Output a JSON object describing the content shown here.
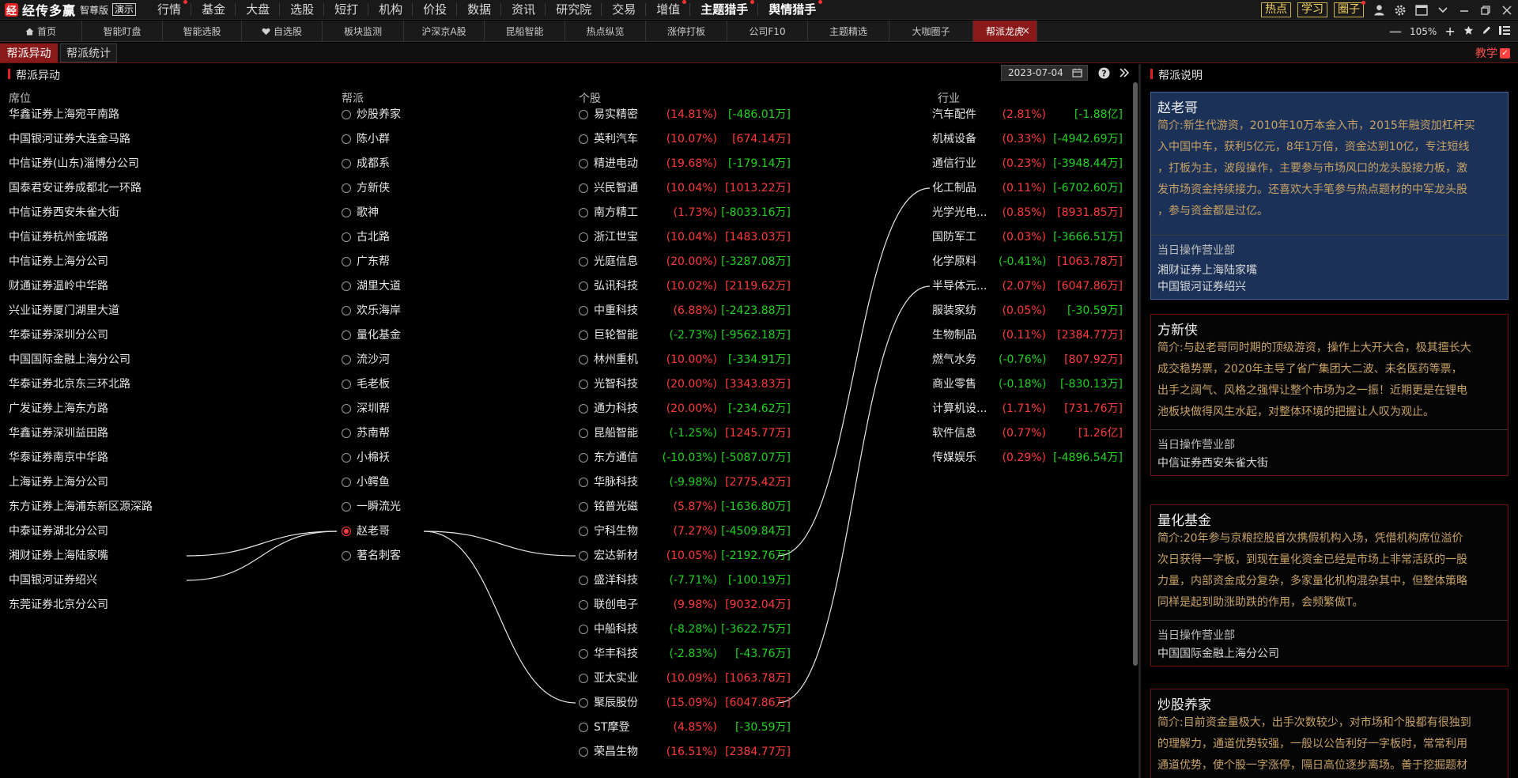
{
  "app": {
    "logo_char": "经",
    "name": "经传多赢",
    "edition": "智尊版",
    "demo_badge": "演示",
    "menu": [
      {
        "label": "行情",
        "dot": true
      },
      {
        "label": "基金",
        "dot": false
      },
      {
        "label": "大盘",
        "dot": false
      },
      {
        "label": "选股",
        "dot": false
      },
      {
        "label": "短打",
        "dot": false
      },
      {
        "label": "机构",
        "dot": false
      },
      {
        "label": "价投",
        "dot": false
      },
      {
        "label": "数据",
        "dot": false
      },
      {
        "label": "资讯",
        "dot": false
      },
      {
        "label": "研究院",
        "dot": false
      },
      {
        "label": "交易",
        "dot": false
      },
      {
        "label": "增值",
        "dot": true
      },
      {
        "label": "主题猎手",
        "dot": true,
        "bold": true
      },
      {
        "label": "舆情猎手",
        "dot": true,
        "bold": true
      }
    ],
    "right_buttons": [
      "热点",
      "学习",
      "圈子"
    ],
    "right_icons": [
      "user-icon",
      "gear-icon",
      "window-icon",
      "chevron-down-icon",
      "minimize-icon",
      "restore-icon",
      "close-icon"
    ]
  },
  "tabs": [
    {
      "label": "首页",
      "icon": "home-icon"
    },
    {
      "label": "智能盯盘"
    },
    {
      "label": "智能选股"
    },
    {
      "label": "自选股",
      "icon": "heart-icon"
    },
    {
      "label": "板块监测"
    },
    {
      "label": "沪深京A股"
    },
    {
      "label": "昆船智能"
    },
    {
      "label": "热点纵览"
    },
    {
      "label": "涨停打板"
    },
    {
      "label": "公司F10"
    },
    {
      "label": "主题精选"
    },
    {
      "label": "大咖圈子"
    },
    {
      "label": "帮派龙虎",
      "active": true,
      "close": "×"
    }
  ],
  "zoom": {
    "minus": "—",
    "value": "105%",
    "plus": "+"
  },
  "subtabs": [
    {
      "label": "帮派异动",
      "active": true
    },
    {
      "label": "帮派统计",
      "active": false
    }
  ],
  "teach_label": "教学",
  "left_panel": {
    "title": "帮派异动",
    "date": "2023-07-04",
    "headers": {
      "seat": "席位",
      "gang": "帮派",
      "stock": "个股",
      "industry": "行业"
    },
    "seats": [
      "华鑫证券上海宛平南路",
      "中国银河证券大连金马路",
      "中信证券(山东)淄博分公司",
      "国泰君安证券成都北一环路",
      "中信证券西安朱雀大街",
      "中信证券杭州金城路",
      "中信证券上海分公司",
      "财通证券温岭中华路",
      "兴业证券厦门湖里大道",
      "华泰证券深圳分公司",
      "中国国际金融上海分公司",
      "华泰证券北京东三环北路",
      "广发证券上海东方路",
      "华鑫证券深圳益田路",
      "华泰证券南京中华路",
      "上海证券上海分公司",
      "东方证券上海浦东新区源深路",
      "中泰证券湖北分公司",
      "湘财证券上海陆家嘴",
      "中国银河证券绍兴",
      "东莞证券北京分公司"
    ],
    "gangs": [
      {
        "name": "炒股养家"
      },
      {
        "name": "陈小群"
      },
      {
        "name": "成都系"
      },
      {
        "name": "方新侠"
      },
      {
        "name": "歌神"
      },
      {
        "name": "古北路"
      },
      {
        "name": "广东帮"
      },
      {
        "name": "湖里大道"
      },
      {
        "name": "欢乐海岸"
      },
      {
        "name": "量化基金"
      },
      {
        "name": "流沙河"
      },
      {
        "name": "毛老板"
      },
      {
        "name": "深圳帮"
      },
      {
        "name": "苏南帮"
      },
      {
        "name": "小棉袄"
      },
      {
        "name": "小鳄鱼"
      },
      {
        "name": "一瞬流光"
      },
      {
        "name": "赵老哥",
        "selected": true
      },
      {
        "name": "著名刺客"
      }
    ],
    "stocks": [
      {
        "name": "易实精密",
        "pct": "(14.81%)",
        "amt": "[-486.01万]",
        "pct_up": true,
        "amt_up": false
      },
      {
        "name": "英利汽车",
        "pct": "(10.07%)",
        "amt": "[674.14万]",
        "pct_up": true,
        "amt_up": true
      },
      {
        "name": "精进电动",
        "pct": "(19.68%)",
        "amt": "[-179.14万]",
        "pct_up": true,
        "amt_up": false
      },
      {
        "name": "兴民智通",
        "pct": "(10.04%)",
        "amt": "[1013.22万]",
        "pct_up": true,
        "amt_up": true
      },
      {
        "name": "南方精工",
        "pct": "(1.73%)",
        "amt": "[-8033.16万]",
        "pct_up": true,
        "amt_up": false
      },
      {
        "name": "浙江世宝",
        "pct": "(10.04%)",
        "amt": "[1483.03万]",
        "pct_up": true,
        "amt_up": true
      },
      {
        "name": "光庭信息",
        "pct": "(20.00%)",
        "amt": "[-3287.08万]",
        "pct_up": true,
        "amt_up": false
      },
      {
        "name": "弘讯科技",
        "pct": "(10.02%)",
        "amt": "[2119.62万]",
        "pct_up": true,
        "amt_up": true
      },
      {
        "name": "中重科技",
        "pct": "(6.88%)",
        "amt": "[-2423.88万]",
        "pct_up": true,
        "amt_up": false
      },
      {
        "name": "巨轮智能",
        "pct": "(-2.73%)",
        "amt": "[-9562.18万]",
        "pct_up": false,
        "amt_up": false
      },
      {
        "name": "林州重机",
        "pct": "(10.00%)",
        "amt": "[-334.91万]",
        "pct_up": true,
        "amt_up": false
      },
      {
        "name": "光智科技",
        "pct": "(20.00%)",
        "amt": "[3343.83万]",
        "pct_up": true,
        "amt_up": true
      },
      {
        "name": "通力科技",
        "pct": "(20.00%)",
        "amt": "[-234.62万]",
        "pct_up": true,
        "amt_up": false
      },
      {
        "name": "昆船智能",
        "pct": "(-1.25%)",
        "amt": "[1245.77万]",
        "pct_up": false,
        "amt_up": true
      },
      {
        "name": "东方通信",
        "pct": "(-10.03%)",
        "amt": "[-5087.07万]",
        "pct_up": false,
        "amt_up": false
      },
      {
        "name": "华脉科技",
        "pct": "(-9.98%)",
        "amt": "[2775.42万]",
        "pct_up": false,
        "amt_up": true
      },
      {
        "name": "铭普光磁",
        "pct": "(5.87%)",
        "amt": "[-1636.80万]",
        "pct_up": true,
        "amt_up": false
      },
      {
        "name": "宁科生物",
        "pct": "(7.27%)",
        "amt": "[-4509.84万]",
        "pct_up": true,
        "amt_up": false
      },
      {
        "name": "宏达新材",
        "pct": "(10.05%)",
        "amt": "[-2192.76万]",
        "pct_up": true,
        "amt_up": false
      },
      {
        "name": "盛洋科技",
        "pct": "(-7.71%)",
        "amt": "[-100.19万]",
        "pct_up": false,
        "amt_up": false
      },
      {
        "name": "联创电子",
        "pct": "(9.98%)",
        "amt": "[9032.04万]",
        "pct_up": true,
        "amt_up": true
      },
      {
        "name": "中船科技",
        "pct": "(-8.28%)",
        "amt": "[-3622.75万]",
        "pct_up": false,
        "amt_up": false
      },
      {
        "name": "华丰科技",
        "pct": "(-2.83%)",
        "amt": "[-43.76万]",
        "pct_up": false,
        "amt_up": false
      },
      {
        "name": "亚太实业",
        "pct": "(10.09%)",
        "amt": "[1063.78万]",
        "pct_up": true,
        "amt_up": true
      },
      {
        "name": "聚辰股份",
        "pct": "(15.09%)",
        "amt": "[6047.86万]",
        "pct_up": true,
        "amt_up": true
      },
      {
        "name": "ST摩登",
        "pct": "(4.85%)",
        "amt": "[-30.59万]",
        "pct_up": true,
        "amt_up": false
      },
      {
        "name": "荣昌生物",
        "pct": "(16.51%)",
        "amt": "[2384.77万]",
        "pct_up": true,
        "amt_up": true
      }
    ],
    "industries": [
      {
        "name": "汽车配件",
        "pct": "(2.81%)",
        "amt": "[-1.88亿]",
        "pct_up": true,
        "amt_up": false
      },
      {
        "name": "机械设备",
        "pct": "(0.33%)",
        "amt": "[-4942.69万]",
        "pct_up": true,
        "amt_up": false
      },
      {
        "name": "通信行业",
        "pct": "(0.23%)",
        "amt": "[-3948.44万]",
        "pct_up": true,
        "amt_up": false
      },
      {
        "name": "化工制品",
        "pct": "(0.11%)",
        "amt": "[-6702.60万]",
        "pct_up": true,
        "amt_up": false
      },
      {
        "name": "光学光电...",
        "pct": "(0.85%)",
        "amt": "[8931.85万]",
        "pct_up": true,
        "amt_up": true
      },
      {
        "name": "国防军工",
        "pct": "(0.03%)",
        "amt": "[-3666.51万]",
        "pct_up": true,
        "amt_up": false
      },
      {
        "name": "化学原料",
        "pct": "(-0.41%)",
        "amt": "[1063.78万]",
        "pct_up": false,
        "amt_up": true
      },
      {
        "name": "半导体元...",
        "pct": "(2.07%)",
        "amt": "[6047.86万]",
        "pct_up": true,
        "amt_up": true
      },
      {
        "name": "服装家纺",
        "pct": "(0.05%)",
        "amt": "[-30.59万]",
        "pct_up": true,
        "amt_up": false
      },
      {
        "name": "生物制品",
        "pct": "(0.11%)",
        "amt": "[2384.77万]",
        "pct_up": true,
        "amt_up": true
      },
      {
        "name": "燃气水务",
        "pct": "(-0.76%)",
        "amt": "[807.92万]",
        "pct_up": false,
        "amt_up": true
      },
      {
        "name": "商业零售",
        "pct": "(-0.18%)",
        "amt": "[-830.13万]",
        "pct_up": false,
        "amt_up": false
      },
      {
        "name": "计算机设...",
        "pct": "(1.71%)",
        "amt": "[731.76万]",
        "pct_up": true,
        "amt_up": true
      },
      {
        "name": "软件信息",
        "pct": "(0.77%)",
        "amt": "[1.26亿]",
        "pct_up": true,
        "amt_up": true
      },
      {
        "name": "传媒娱乐",
        "pct": "(0.29%)",
        "amt": "[-4896.54万]",
        "pct_up": true,
        "amt_up": false
      }
    ],
    "links": {
      "selected_gang": "赵老哥",
      "seats": [
        "湘财证券上海陆家嘴",
        "中国银河证券绍兴"
      ],
      "stocks": [
        "宏达新材",
        "聚辰股份"
      ],
      "industries": [
        "化工制品",
        "半导体元..."
      ]
    }
  },
  "right_panel": {
    "title": "帮派说明",
    "cards": [
      {
        "name": "赵老哥",
        "selected": true,
        "desc_lines": [
          "简介:新生代游资，2010年10万本金入市，2015年融资加杠杆买",
          "入中国中车，获利5亿元，8年1万倍，资金达到10亿，专注短线",
          "，打板为主，波段操作，主要参与市场风口的龙头股接力板，激",
          "发市场资金持续接力。还喜欢大手笔参与热点题材的中军龙头股",
          "，参与资金都是过亿。"
        ],
        "ops_label": "当日操作营业部",
        "ops": [
          "湘财证券上海陆家嘴",
          "中国银河证券绍兴"
        ]
      },
      {
        "name": "方新侠",
        "selected": false,
        "desc_lines": [
          "简介:与赵老哥同时期的顶级游资，操作上大开大合，极其擅长大",
          "成交稳势票，2020年主导了省广集团大二波、未名医药等票，",
          "出手之阔气、风格之强悍让整个市场为之一振！近期更是在锂电",
          "池板块做得风生水起，对整体环境的把握让人叹为观止。"
        ],
        "ops_label": "当日操作营业部",
        "ops": [
          "中信证券西安朱雀大街"
        ]
      },
      {
        "name": "量化基金",
        "selected": false,
        "desc_lines": [
          "简介:20年参与京粮控股首次携假机构入场，凭借机构席位溢价",
          "次日获得一字板，到现在量化资金已经是市场上非常活跃的一股",
          "力量，内部资金成分复杂，多家量化机构混杂其中，但整体策略",
          "同样是起到助涨助跌的作用，会频繁做T。"
        ],
        "ops_label": "当日操作营业部",
        "ops": [
          "中国国际金融上海分公司"
        ]
      },
      {
        "name": "炒股养家",
        "selected": false,
        "desc_lines": [
          "简介:目前资金量极大，出手次数较少，对市场和个股都有很独到",
          "的理解力，通道优势较强，一般以公告利好一字板时，常常利用",
          "通道优势，使个股一字涨停，隔日高位逐步离场。善于挖掘题材"
        ],
        "ops_label": "",
        "ops": []
      }
    ]
  },
  "colors": {
    "up": "#ff3b3b",
    "down": "#1fd41f",
    "accent": "#8a1a1a",
    "desc": "#c8a265",
    "card_sel": "#1c3157"
  }
}
